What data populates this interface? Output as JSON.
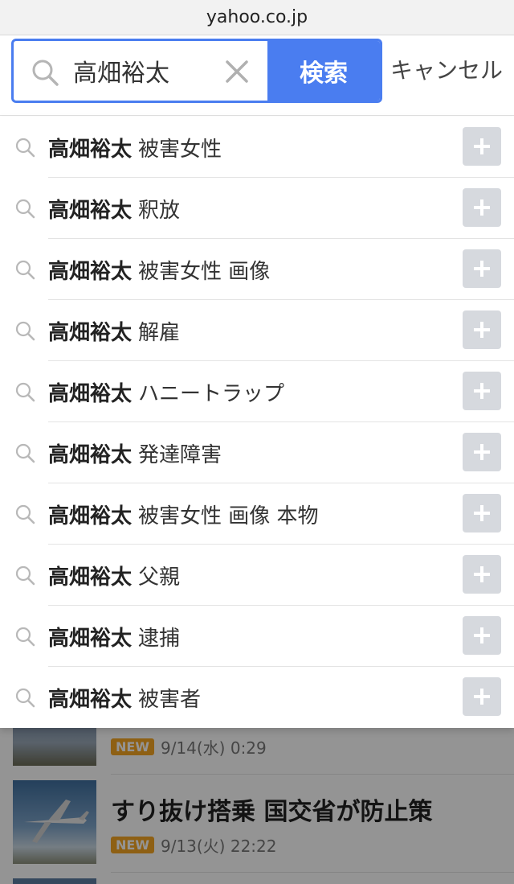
{
  "browser": {
    "url": "yahoo.co.jp"
  },
  "search": {
    "query": "高畑裕太",
    "button_label": "検索",
    "cancel_label": "キャンセル"
  },
  "suggestions": [
    {
      "base": "高畑裕太",
      "suffix": "被害女性"
    },
    {
      "base": "高畑裕太",
      "suffix": "釈放"
    },
    {
      "base": "高畑裕太",
      "suffix": "被害女性 画像"
    },
    {
      "base": "高畑裕太",
      "suffix": "解雇"
    },
    {
      "base": "高畑裕太",
      "suffix": "ハニートラップ"
    },
    {
      "base": "高畑裕太",
      "suffix": "発達障害"
    },
    {
      "base": "高畑裕太",
      "suffix": "被害女性 画像 本物"
    },
    {
      "base": "高畑裕太",
      "suffix": "父親"
    },
    {
      "base": "高畑裕太",
      "suffix": "逮捕"
    },
    {
      "base": "高畑裕太",
      "suffix": "被害者"
    }
  ],
  "news": [
    {
      "badge": "NEW",
      "time": "9/14(水) 0:29"
    },
    {
      "title": "すり抜け搭乗 国交省が防止策",
      "badge": "NEW",
      "time": "9/13(火) 22:22"
    }
  ],
  "colors": {
    "accent": "#4a7df0",
    "badge": "#f5a623",
    "plus_bg": "#d6d9de"
  }
}
